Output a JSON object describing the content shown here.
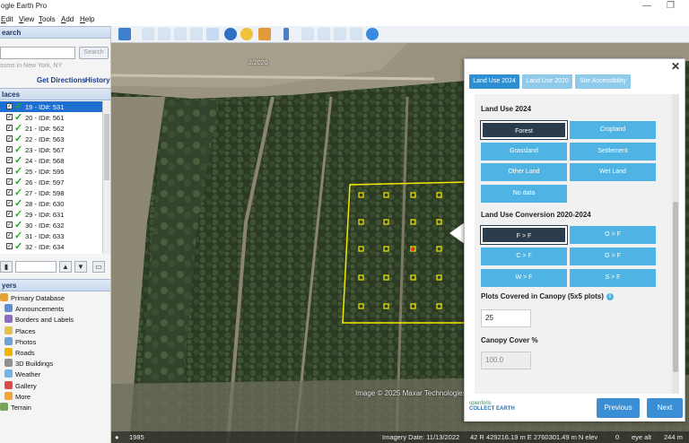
{
  "app": {
    "title": "ogle Earth Pro"
  },
  "window": {
    "restore_glyph": "❐",
    "minimize_glyph": "—"
  },
  "menu": [
    "Edit",
    "View",
    "Tools",
    "Add",
    "Help"
  ],
  "search": {
    "header": "earch",
    "button": "Search",
    "placeholder_hint": "sums in New York, NY",
    "get_directions": "Get Directions",
    "history": "History"
  },
  "places": {
    "header": "laces",
    "items": [
      {
        "label": "19 - ID#: 531",
        "selected": true
      },
      {
        "label": "20 - ID#: 561",
        "selected": false
      },
      {
        "label": "21 - ID#: 562",
        "selected": false
      },
      {
        "label": "22 - ID#: 563",
        "selected": false
      },
      {
        "label": "23 - ID#: 567",
        "selected": false
      },
      {
        "label": "24 - ID#: 568",
        "selected": false
      },
      {
        "label": "25 - ID#: 595",
        "selected": false
      },
      {
        "label": "26 - ID#: 597",
        "selected": false
      },
      {
        "label": "27 - ID#: 598",
        "selected": false
      },
      {
        "label": "28 - ID#: 630",
        "selected": false
      },
      {
        "label": "29 - ID#: 631",
        "selected": false
      },
      {
        "label": "30 - ID#: 632",
        "selected": false
      },
      {
        "label": "31 - ID#: 633",
        "selected": false
      },
      {
        "label": "32 - ID#: 634",
        "selected": false
      }
    ],
    "toolbar": {
      "up": "▲",
      "down": "▼"
    }
  },
  "layers": {
    "header": "yers",
    "items": [
      {
        "label": "Primary Database",
        "indent": 0,
        "color": "#e3a23a"
      },
      {
        "label": "Announcements",
        "indent": 1,
        "color": "#5e8fd0"
      },
      {
        "label": "Borders and Labels",
        "indent": 1,
        "color": "#8a6fbf"
      },
      {
        "label": "Places",
        "indent": 1,
        "color": "#e1c246"
      },
      {
        "label": "Photos",
        "indent": 1,
        "color": "#6aa5d6"
      },
      {
        "label": "Roads",
        "indent": 1,
        "color": "#f0b400"
      },
      {
        "label": "3D Buildings",
        "indent": 1,
        "color": "#8f8f8f"
      },
      {
        "label": "Weather",
        "indent": 1,
        "color": "#6fb3e8"
      },
      {
        "label": "Gallery",
        "indent": 1,
        "color": "#d94b4b"
      },
      {
        "label": "More",
        "indent": 1,
        "color": "#f2a33a"
      },
      {
        "label": "Terrain",
        "indent": 0,
        "color": "#7aa35a"
      }
    ]
  },
  "map": {
    "date_overlay": "2/2020",
    "credit": "Image © 2025 Maxar Technologies",
    "status": {
      "year": "1985",
      "imagery_date": "Imagery Date: 11/13/2022",
      "coords": "42 R  429216.19 m E  2760301.49 m N  elev",
      "zero": "0",
      "eye_alt": "eye alt",
      "alt_value": "244 m"
    }
  },
  "collect_earth": {
    "close": "✕",
    "tabs": [
      "Land Use 2024",
      "Land Use 2020",
      "Site Accessibility"
    ],
    "land_use_title": "Land Use 2024",
    "land_use_options": [
      {
        "label": "Forest",
        "selected": true
      },
      {
        "label": "Cropland",
        "selected": false
      },
      {
        "label": "Grassland",
        "selected": false
      },
      {
        "label": "Settlement",
        "selected": false
      },
      {
        "label": "Other Land",
        "selected": false
      },
      {
        "label": "Wet Land",
        "selected": false
      },
      {
        "label": "No data",
        "selected": false
      }
    ],
    "conversion_title": "Land Use Conversion 2020-2024",
    "conversion_options": [
      {
        "label": "F > F",
        "selected": true
      },
      {
        "label": "O > F",
        "selected": false
      },
      {
        "label": "C > F",
        "selected": false
      },
      {
        "label": "G > F",
        "selected": false
      },
      {
        "label": "W > F",
        "selected": false
      },
      {
        "label": "S > F",
        "selected": false
      }
    ],
    "plots_title": "Plots Covered in Canopy (5x5 plots)",
    "plots_value": "25",
    "canopy_title": "Canopy Cover %",
    "canopy_value": "100.0",
    "logo_top": "openforis",
    "logo_bottom": "COLLECT EARTH",
    "previous": "Previous",
    "next": "Next",
    "colors": {
      "tab_active": "#2f8fd3",
      "tab_inactive": "#8fcaeb",
      "option": "#4fb3e3",
      "option_selected": "#2a3b4c"
    }
  }
}
